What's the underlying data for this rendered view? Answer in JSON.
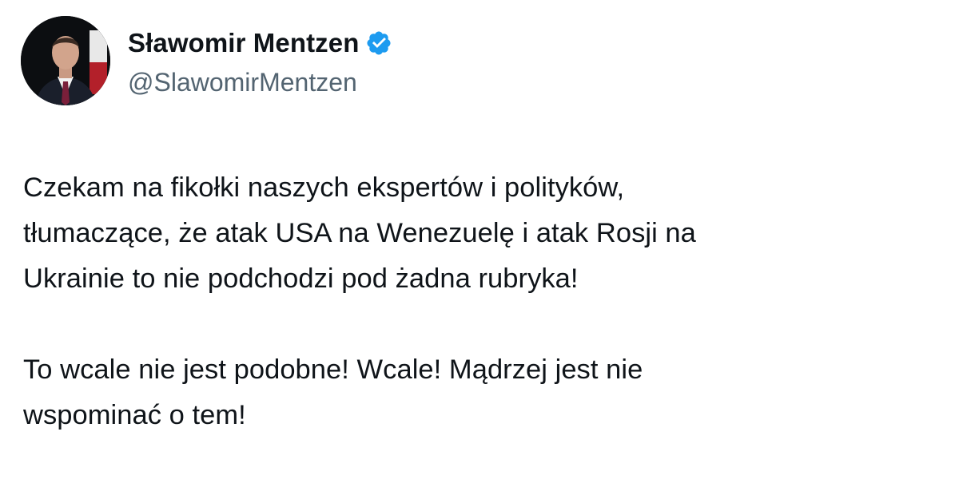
{
  "author": {
    "display_name": "Sławomir Mentzen",
    "handle": "@SlawomirMentzen",
    "verified": true,
    "avatar_icon": "profile-photo",
    "verified_icon": "verified-badge-icon"
  },
  "tweet": {
    "paragraphs": [
      {
        "lines": [
          "Czekam na fikołki naszych ekspertów i polityków,",
          "tłumaczące, że atak USA na Wenezuelę i atak Rosji na",
          "Ukrainie to nie podchodzi pod żadna rubryka!"
        ]
      },
      {
        "lines": [
          "To wcale nie jest podobne! Wcale! Mądrzej jest nie",
          "wspominać o tem!"
        ]
      }
    ]
  },
  "colors": {
    "text_primary": "#0f1419",
    "text_secondary": "#536471",
    "verified_blue": "#1d9bf0",
    "background": "#ffffff"
  }
}
